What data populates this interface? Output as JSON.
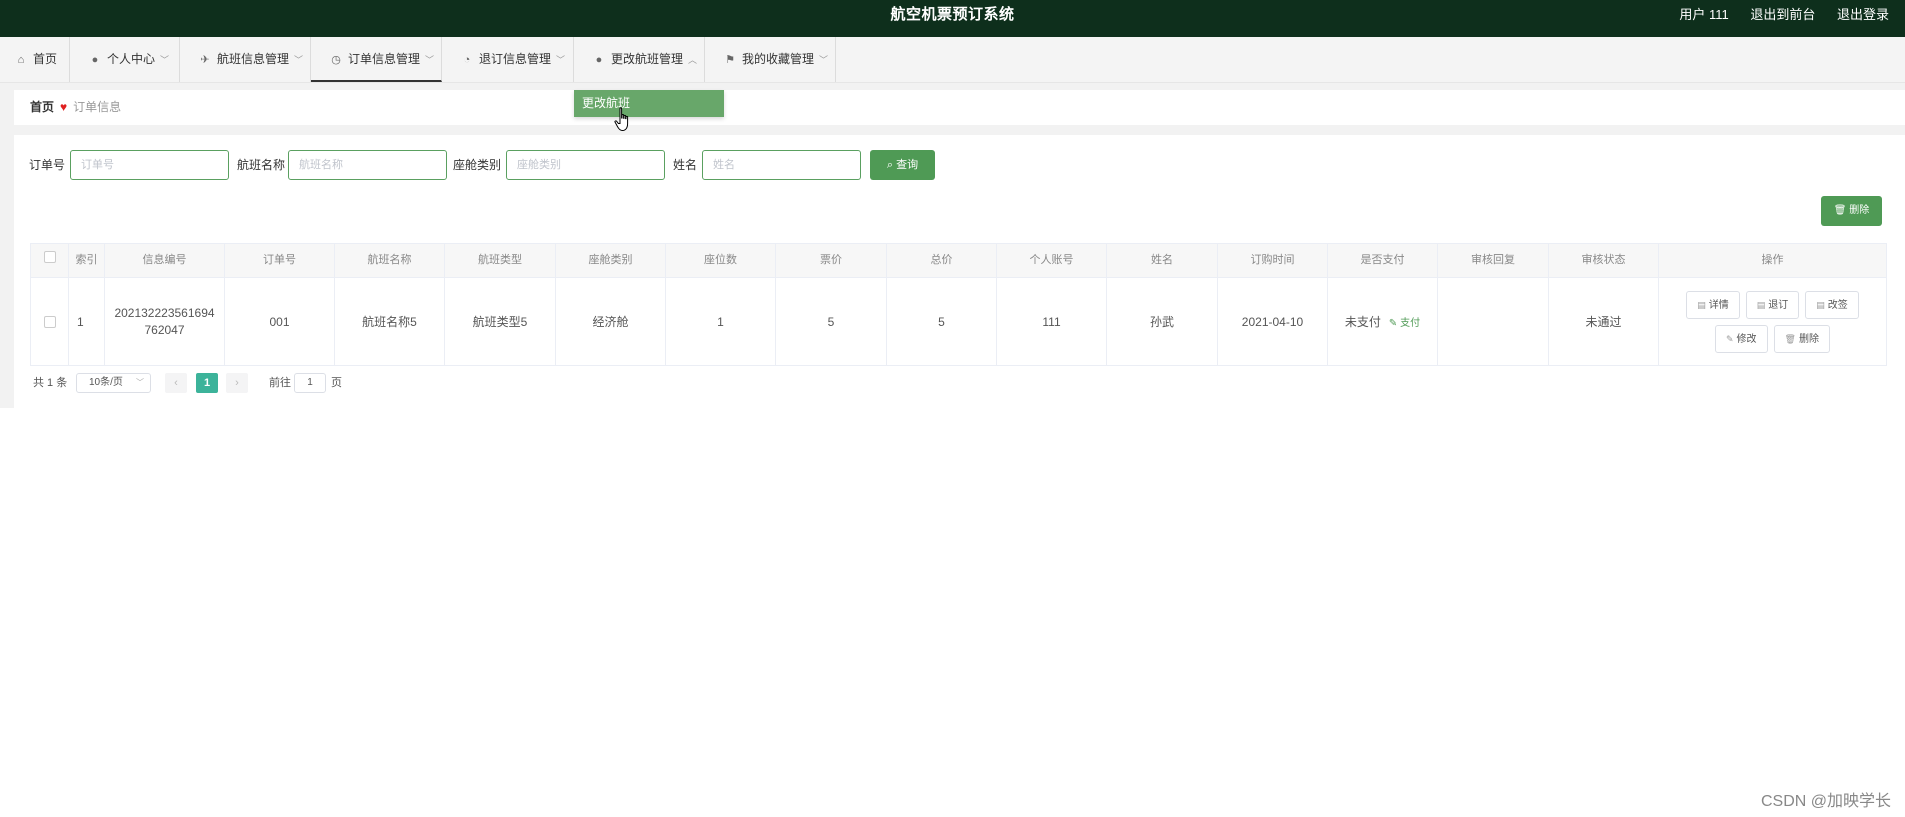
{
  "header": {
    "title": "航空机票预订系统",
    "user": "用户 111",
    "back_to_front": "退出到前台",
    "logout": "退出登录",
    "bg_color": "#0e2f1c"
  },
  "nav": {
    "items": [
      {
        "label": "首页",
        "icon": "home-icon"
      },
      {
        "label": "个人中心",
        "icon": "user-icon"
      },
      {
        "label": "航班信息管理",
        "icon": "plane-icon"
      },
      {
        "label": "订单信息管理",
        "icon": "clock-icon"
      },
      {
        "label": "退订信息管理",
        "icon": "compass-icon"
      },
      {
        "label": "更改航班管理",
        "icon": "user-icon"
      },
      {
        "label": "我的收藏管理",
        "icon": "flag-icon"
      }
    ],
    "dropdown_item": "更改航班"
  },
  "breadcrumb": {
    "home": "首页",
    "current": "订单信息"
  },
  "search": {
    "order_no": {
      "label": "订单号",
      "placeholder": "订单号"
    },
    "flight_name": {
      "label": "航班名称",
      "placeholder": "航班名称"
    },
    "cabin_type": {
      "label": "座舱类别",
      "placeholder": "座舱类别"
    },
    "name": {
      "label": "姓名",
      "placeholder": "姓名"
    },
    "query_button": "查询",
    "delete_button": "删除",
    "accent_color": "#4f9a55"
  },
  "table": {
    "columns": [
      "索引",
      "信息编号",
      "订单号",
      "航班名称",
      "航班类型",
      "座舱类别",
      "座位数",
      "票价",
      "总价",
      "个人账号",
      "姓名",
      "订购时间",
      "是否支付",
      "审核回复",
      "审核状态",
      "操作"
    ],
    "rows": [
      {
        "index": "1",
        "info_no": "202132223561694762047",
        "order_no": "001",
        "flight_name": "航班名称5",
        "flight_type": "航班类型5",
        "cabin": "经济舱",
        "seats": "1",
        "price": "5",
        "total": "5",
        "account": "111",
        "name": "孙武",
        "order_time": "2021-04-10",
        "paid": "未支付",
        "pay_link": "支付",
        "reply": "",
        "status": "未通过",
        "actions": [
          "详情",
          "退订",
          "改签",
          "修改",
          "删除"
        ]
      }
    ]
  },
  "pagination": {
    "total": "共 1 条",
    "page_size": "10条/页",
    "current_page": "1",
    "goto_label": "前往",
    "goto_value": "1",
    "page_unit": "页"
  },
  "watermark": "CSDN @加映学长"
}
